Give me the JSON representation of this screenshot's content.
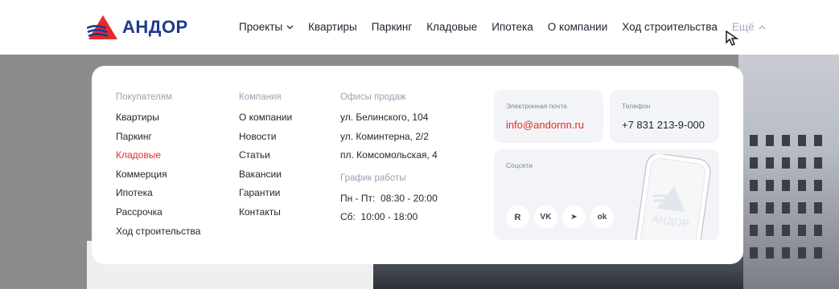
{
  "logo": {
    "text": "АНДОР"
  },
  "nav": {
    "items": [
      {
        "label": "Проекты",
        "has_dropdown": true
      },
      {
        "label": "Квартиры"
      },
      {
        "label": "Паркинг"
      },
      {
        "label": "Кладовые"
      },
      {
        "label": "Ипотека"
      },
      {
        "label": "О компании"
      },
      {
        "label": "Ход строительства"
      },
      {
        "label": "Ещё",
        "has_dropdown": true,
        "open": true
      }
    ]
  },
  "menu": {
    "buyers": {
      "title": "Покупателям",
      "items": [
        "Квартиры",
        "Паркинг",
        "Кладовые",
        "Коммерция",
        "Ипотека",
        "Рассрочка",
        "Ход строительства"
      ],
      "active": "Кладовые"
    },
    "company": {
      "title": "Компания",
      "items": [
        "О компании",
        "Новости",
        "Статьи",
        "Вакансии",
        "Гарантии",
        "Контакты"
      ]
    },
    "offices": {
      "title": "Офисы продаж",
      "items": [
        "ул. Белинского, 104",
        "ул. Коминтерна, 2/2",
        "пл. Комсомольская, 4"
      ]
    },
    "schedule": {
      "title": "График работы",
      "items": [
        "Пн - Пт:  08:30 - 20:00",
        "Сб:  10:00 - 18:00"
      ]
    },
    "email": {
      "label": "Электронная почта",
      "value": "info@andornn.ru"
    },
    "phone": {
      "label": "Телефон",
      "value": "+7 831 213-9-000"
    },
    "socials": {
      "label": "Соцсети",
      "items": [
        {
          "name": "rutube",
          "glyph": "R"
        },
        {
          "name": "vk",
          "glyph": "VK"
        },
        {
          "name": "telegram",
          "glyph": "➤"
        },
        {
          "name": "odnoklassniki",
          "glyph": "ok"
        }
      ],
      "phone_brand": "АНДОР"
    }
  },
  "colors": {
    "accent_red": "#e32b2b",
    "brand_blue": "#1d3a8f",
    "muted": "#9aa2b1"
  }
}
